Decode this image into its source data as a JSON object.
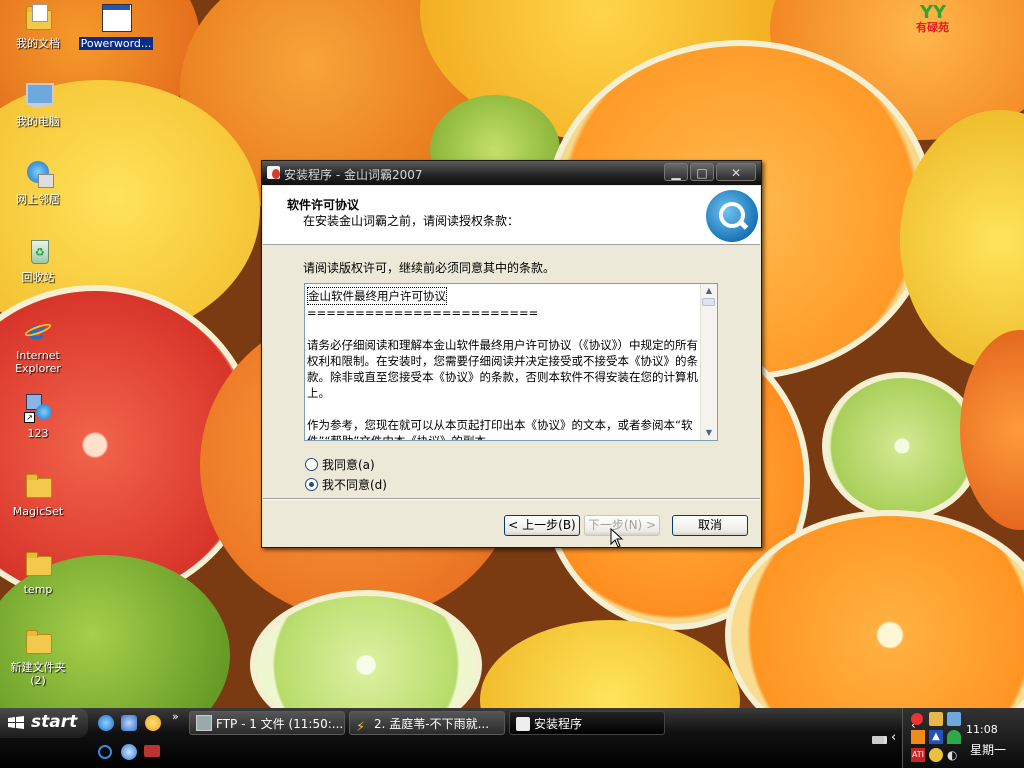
{
  "colors": {
    "accent": "#0b2d86",
    "dialog_bg": "#ece9d8",
    "titlebar": "#222222"
  },
  "desktop": {
    "watermark": "有碌苑",
    "icons": [
      {
        "label": "我的文档",
        "icon": "my-documents-icon"
      },
      {
        "label": "Powerword...",
        "icon": "program-window-icon"
      },
      {
        "label": "我的电脑",
        "icon": "my-computer-icon"
      },
      {
        "label": "网上邻居",
        "icon": "network-icon"
      },
      {
        "label": "回收站",
        "icon": "recycle-bin-icon"
      },
      {
        "label": "Internet Explorer",
        "icon": "internet-explorer-icon"
      },
      {
        "label": "123",
        "icon": "network-shortcut-icon"
      },
      {
        "label": "MagicSet",
        "icon": "folder-icon"
      },
      {
        "label": "temp",
        "icon": "folder-icon"
      },
      {
        "label": "新建文件夹 (2)",
        "icon": "folder-icon"
      }
    ]
  },
  "dialog": {
    "title": "安装程序 - 金山词霸2007",
    "header_title": "软件许可协议",
    "header_subtitle": "在安装金山词霸之前，请阅读授权条款：",
    "instruction": "请阅读版权许可，继续前必须同意其中的条款。",
    "license": {
      "title": "金山软件最终用户许可协议",
      "rule": "========================",
      "para1": "请务必仔细阅读和理解本金山软件最终用户许可协议（《协议》）中规定的所有权利和限制。在安装时，您需要仔细阅读并决定接受或不接受本《协议》的条款。除非或直至您接受本《协议》的条款，否则本软件不得安装在您的计算机上。",
      "para2": "作为参考，您现在就可以从本页起打印出本《协议》的文本，或者参阅本“软件”“帮助”文件中本《协议》的副本。"
    },
    "agree_label": "我同意(a)",
    "disagree_label": "我不同意(d)",
    "selected": "disagree",
    "back_button": "< 上一步(B)",
    "next_button": "下一步(N) >",
    "cancel_button": "取消"
  },
  "taskbar": {
    "start_label": "start",
    "tasks": [
      {
        "label": "FTP - 1 文件 (11:50:...",
        "active": false
      },
      {
        "label": "2. 孟庭苇-不下雨就...",
        "active": false
      },
      {
        "label": "安装程序",
        "active": true
      }
    ],
    "clock": "11:08",
    "weekday": "星期一"
  }
}
